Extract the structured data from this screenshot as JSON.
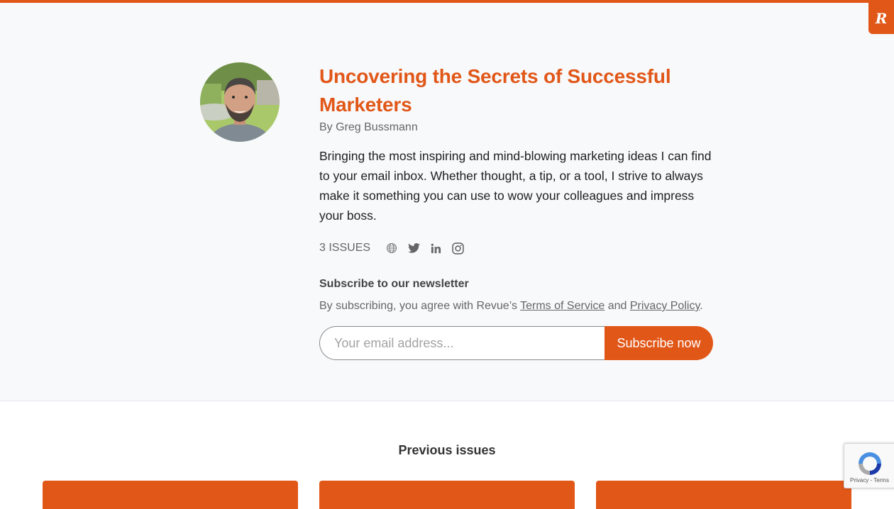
{
  "brand": {
    "accent_color": "#e15718",
    "badge_letter": "R"
  },
  "profile": {
    "title": "Uncovering the Secrets of Successful Marketers",
    "byline": "By Greg Bussmann",
    "description": "Bringing the most inspiring and mind-blowing marketing ideas I can find to your email inbox. Whether thought, a tip, or a tool, I strive to always make it something you can use to wow your colleagues and impress your boss.",
    "issues_count": "3 ISSUES",
    "social_icons": [
      "globe-icon",
      "twitter-icon",
      "linkedin-icon",
      "instagram-icon"
    ]
  },
  "subscribe": {
    "heading": "Subscribe to our newsletter",
    "agree_prefix": "By subscribing, you agree with Revue’s ",
    "terms_link": "Terms of Service",
    "agree_middle": " and ",
    "privacy_link": "Privacy Policy",
    "agree_suffix": ".",
    "email_placeholder": "Your email address...",
    "email_value": "",
    "button_label": "Subscribe now"
  },
  "previous_issues": {
    "heading": "Previous issues"
  },
  "recaptcha": {
    "links": "Privacy - Terms"
  }
}
